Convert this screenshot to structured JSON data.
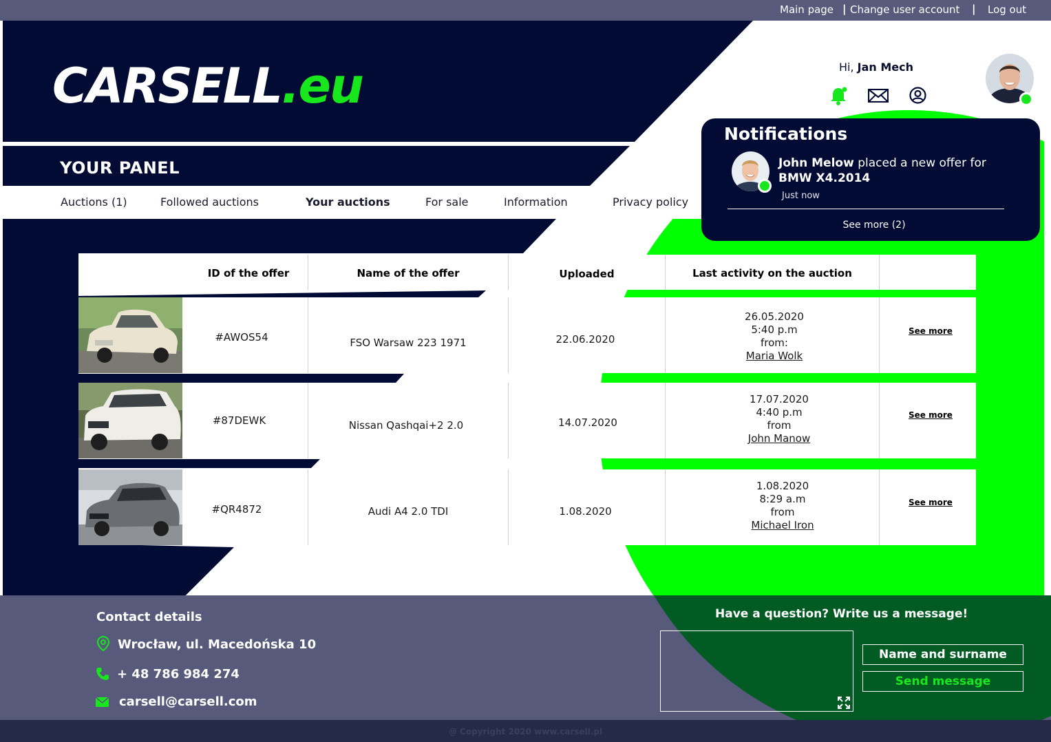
{
  "top_nav": {
    "main_page": "Main page",
    "change_account": "Change user account",
    "log_out": "Log out",
    "separator": "|"
  },
  "logo": {
    "name": "CARSELL",
    "suffix": ".eu"
  },
  "user": {
    "greeting": "Hi,",
    "name": "Jan Mech"
  },
  "panel": {
    "title": "YOUR PANEL"
  },
  "tabs": [
    {
      "label": "Auctions (1)"
    },
    {
      "label": "Followed auctions"
    },
    {
      "label": "Your auctions",
      "active": true
    },
    {
      "label": "For sale"
    },
    {
      "label": "Information"
    },
    {
      "label": "Privacy policy"
    }
  ],
  "notifications": {
    "title": "Notifications",
    "sender": "John Melow",
    "text": "placed a new offer for",
    "item": "BMW X4.2014",
    "time": "Just now",
    "see_more": "See more (2)"
  },
  "table": {
    "headers": [
      "ID of the offer",
      "Name of the offer",
      "Uploaded",
      "Last activity on the auction"
    ],
    "rows": [
      {
        "thumb": "vintage-car-photo",
        "id": "#AWOS54",
        "name": "FSO Warsaw 223 1971",
        "uploaded": "22.06.2020",
        "date": "26.05.2020",
        "time": "5:40 p.m",
        "from": "from:",
        "user": "Maria Wolk",
        "action": "See more"
      },
      {
        "thumb": "suv-car-photo",
        "id": "#87DEWK",
        "name": "Nissan Qashqai+2 2.0",
        "uploaded": "14.07.2020",
        "date": "17.07.2020",
        "time": "4:40 p.m",
        "from": "from",
        "user": "John Manow",
        "action": "See more"
      },
      {
        "thumb": "sedan-car-photo",
        "id": "#QR4872",
        "name": "Audi A4 2.0 TDI",
        "uploaded": "1.08.2020",
        "date": "1.08.2020",
        "time": "8:29 a.m",
        "from": "from",
        "user": "Michael Iron",
        "action": "See more"
      }
    ]
  },
  "contact": {
    "title": "Contact details",
    "address": "Wrocław, ul. Macedońska 10",
    "phone": "+ 48 786 984 274",
    "email": "carsell@carsell.com"
  },
  "message_form": {
    "title": "Have a question? Write us a message!",
    "name_button": "Name and surname",
    "send_button": "Send message"
  },
  "footer": {
    "copyright": "@ Copyright 2020 www.carsell.pl"
  },
  "colors": {
    "navy": "#020b33",
    "green": "#00ff00",
    "slate": "#575a7b",
    "dark_green": "#035b24"
  }
}
